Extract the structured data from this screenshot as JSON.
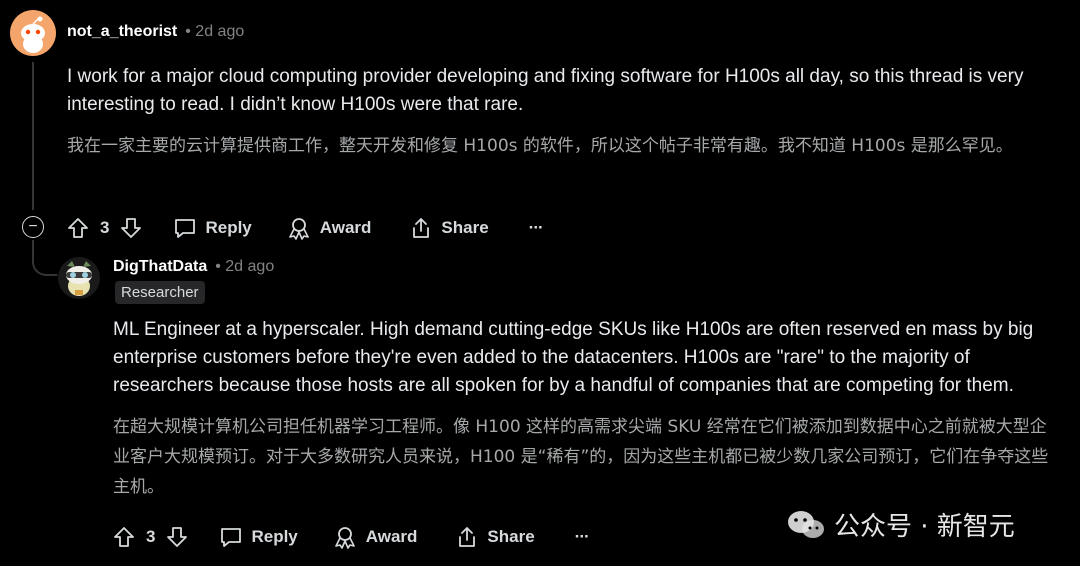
{
  "comment1": {
    "username": "not_a_theorist",
    "time": "• 2d ago",
    "body_en": "I work for a major cloud computing provider developing and fixing software for H100s all day, so this thread is very interesting to read. I didn’t know H100s were that rare.",
    "body_zh": "我在一家主要的云计算提供商工作，整天开发和修复 H100s 的软件，所以这个帖子非常有趣。我不知道 H100s 是那么罕见。",
    "votes": "3",
    "reply_label": "Reply",
    "award_label": "Award",
    "share_label": "Share",
    "more_label": "···",
    "collapse_label": "−"
  },
  "comment2": {
    "username": "DigThatData",
    "time": "• 2d ago",
    "flair": "Researcher",
    "body_en": "ML Engineer at a hyperscaler. High demand cutting-edge SKUs like H100s are often reserved en mass by big enterprise customers before they're even added to the datacenters. H100s are \"rare\" to the majority of researchers because those hosts are all spoken for by a handful of companies that are competing for them.",
    "body_zh": "在超大规模计算机公司担任机器学习工程师。像 H100 这样的高需求尖端 SKU 经常在它们被添加到数据中心之前就被大型企业客户大规模预订。对于大多数研究人员来说，H100 是“稀有”的，因为这些主机都已被少数几家公司预订，它们在争夺这些主机。",
    "votes": "3",
    "reply_label": "Reply",
    "award_label": "Award",
    "share_label": "Share",
    "more_label": "···"
  },
  "watermark": {
    "text": "公众号 · 新智元"
  },
  "colors": {
    "background": "#000000",
    "text": "#d7dadc",
    "muted": "#818384",
    "avatar1": "#f4a56b"
  }
}
